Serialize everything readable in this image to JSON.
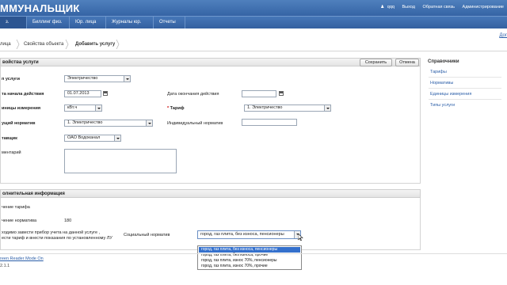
{
  "header": {
    "app_title": "ММУНАЛЬЩИК",
    "user": "qqq",
    "links": [
      "Выход",
      "Обратная связь",
      "Администрирование"
    ]
  },
  "nav": {
    "tabs": [
      "з. лица",
      "Биллинг физ.",
      "Юр. лица",
      "Журналы юр.",
      "Отчеты"
    ]
  },
  "breadcrumb": [
    "лица",
    "Свойства объекта",
    "Добавить услугу"
  ],
  "help_link": "Дог",
  "service_panel": {
    "title": "войства услуги",
    "save_label": "Сохранить",
    "cancel_label": "Отмена",
    "fields": {
      "service_label": "п услуги",
      "service_value": "Электричество",
      "start_date_label": "та начала действия",
      "start_date_value": "01.07.2013",
      "end_date_label": "Дата окончания действия",
      "end_date_value": "",
      "unit_label": "иницы измерения",
      "unit_value": "кВт.ч",
      "tariff_label": "Тариф",
      "tariff_value": "1. Электричество",
      "norm_label": "ущий норматив",
      "norm_value": "1. Электричество",
      "indiv_norm_label": "Индивидуальный норматив",
      "indiv_norm_value": "",
      "supplier_label": "тавщик",
      "supplier_value": "ОАО Водоканал",
      "comment_label": "ментарий",
      "comment_value": ""
    }
  },
  "extra_panel": {
    "title": "олнительная информация",
    "tariff_value_label": "чение тарифа",
    "norm_value_label": "чение норматива",
    "norm_value": "180",
    "meter_note_line1": "ходимо завести прибор учета на данной услуге ,",
    "meter_note_line2": "ести тариф и внести показания по установленному ЛУ",
    "social_norm_label": "Социальный норматив",
    "social_norm_value": "город, газ плита, без износа, пенсионеры"
  },
  "dropdown_options": [
    "город, газ плита, без износа, пенсионеры",
    "город, газ плита, без износа, прочие",
    "город, газ плита, износ 70%, пенсионеры",
    "город, газ плита, износ 70%, прочие"
  ],
  "sidebar": {
    "title": "Справочники",
    "items": [
      "Тарифы",
      "Нормативы",
      "Единицы измерения",
      "Типы услуги"
    ]
  },
  "footer": {
    "screen_reader": "reen Reader Mode On",
    "version": "2.1.1"
  },
  "colors": {
    "header_blue": "#3f6fb0",
    "link_blue": "#2b5ea8",
    "selected_option": "#3470cc"
  }
}
